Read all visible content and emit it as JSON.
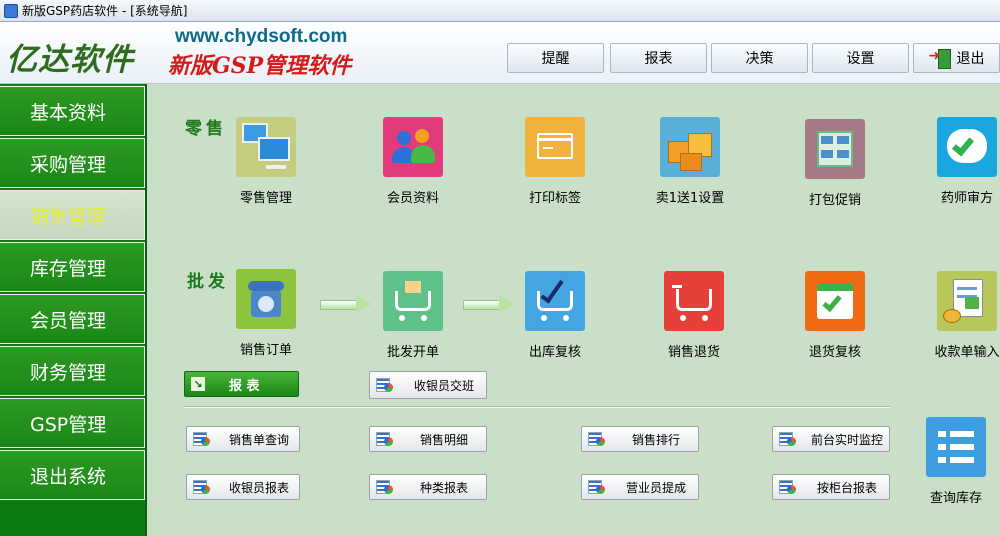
{
  "window": {
    "title": "新版GSP药店软件 - [系统导航]"
  },
  "header": {
    "logo": "亿达软件",
    "url": "www.chydsoft.com",
    "subtitle": "新版GSP管理软件",
    "nav": [
      "提醒",
      "报表",
      "决策",
      "设置",
      "退出"
    ]
  },
  "sidebar": {
    "items": [
      "基本资料",
      "采购管理",
      "销售管理",
      "库存管理",
      "会员管理",
      "财务管理",
      "GSP管理",
      "退出系统"
    ],
    "active_index": 2
  },
  "main": {
    "retail_label": "零售",
    "wholesale_label": "批发",
    "retail_tiles": [
      "零售管理",
      "会员资料",
      "打印标签",
      "卖1送1设置",
      "打包促销",
      "药师审方"
    ],
    "wholesale_tiles": [
      "销售订单",
      "批发开单",
      "出库复核",
      "销售退货",
      "退货复核",
      "收款单输入"
    ],
    "report_tab": "报 表",
    "cashier_shift": "收银员交班",
    "report_buttons": [
      "销售单查询",
      "销售明细",
      "销售排行",
      "前台实时监控",
      "收银员报表",
      "种类报表",
      "营业员提成",
      "按柜台报表"
    ],
    "stock_query": "查询库存"
  },
  "colors": {
    "sidebar_bg": "#0d7c12",
    "main_bg": "#c9dfc7",
    "active_text": "#e2ef36",
    "logo_green": "#2e6d1f",
    "subtitle_red": "#d21c1c"
  }
}
